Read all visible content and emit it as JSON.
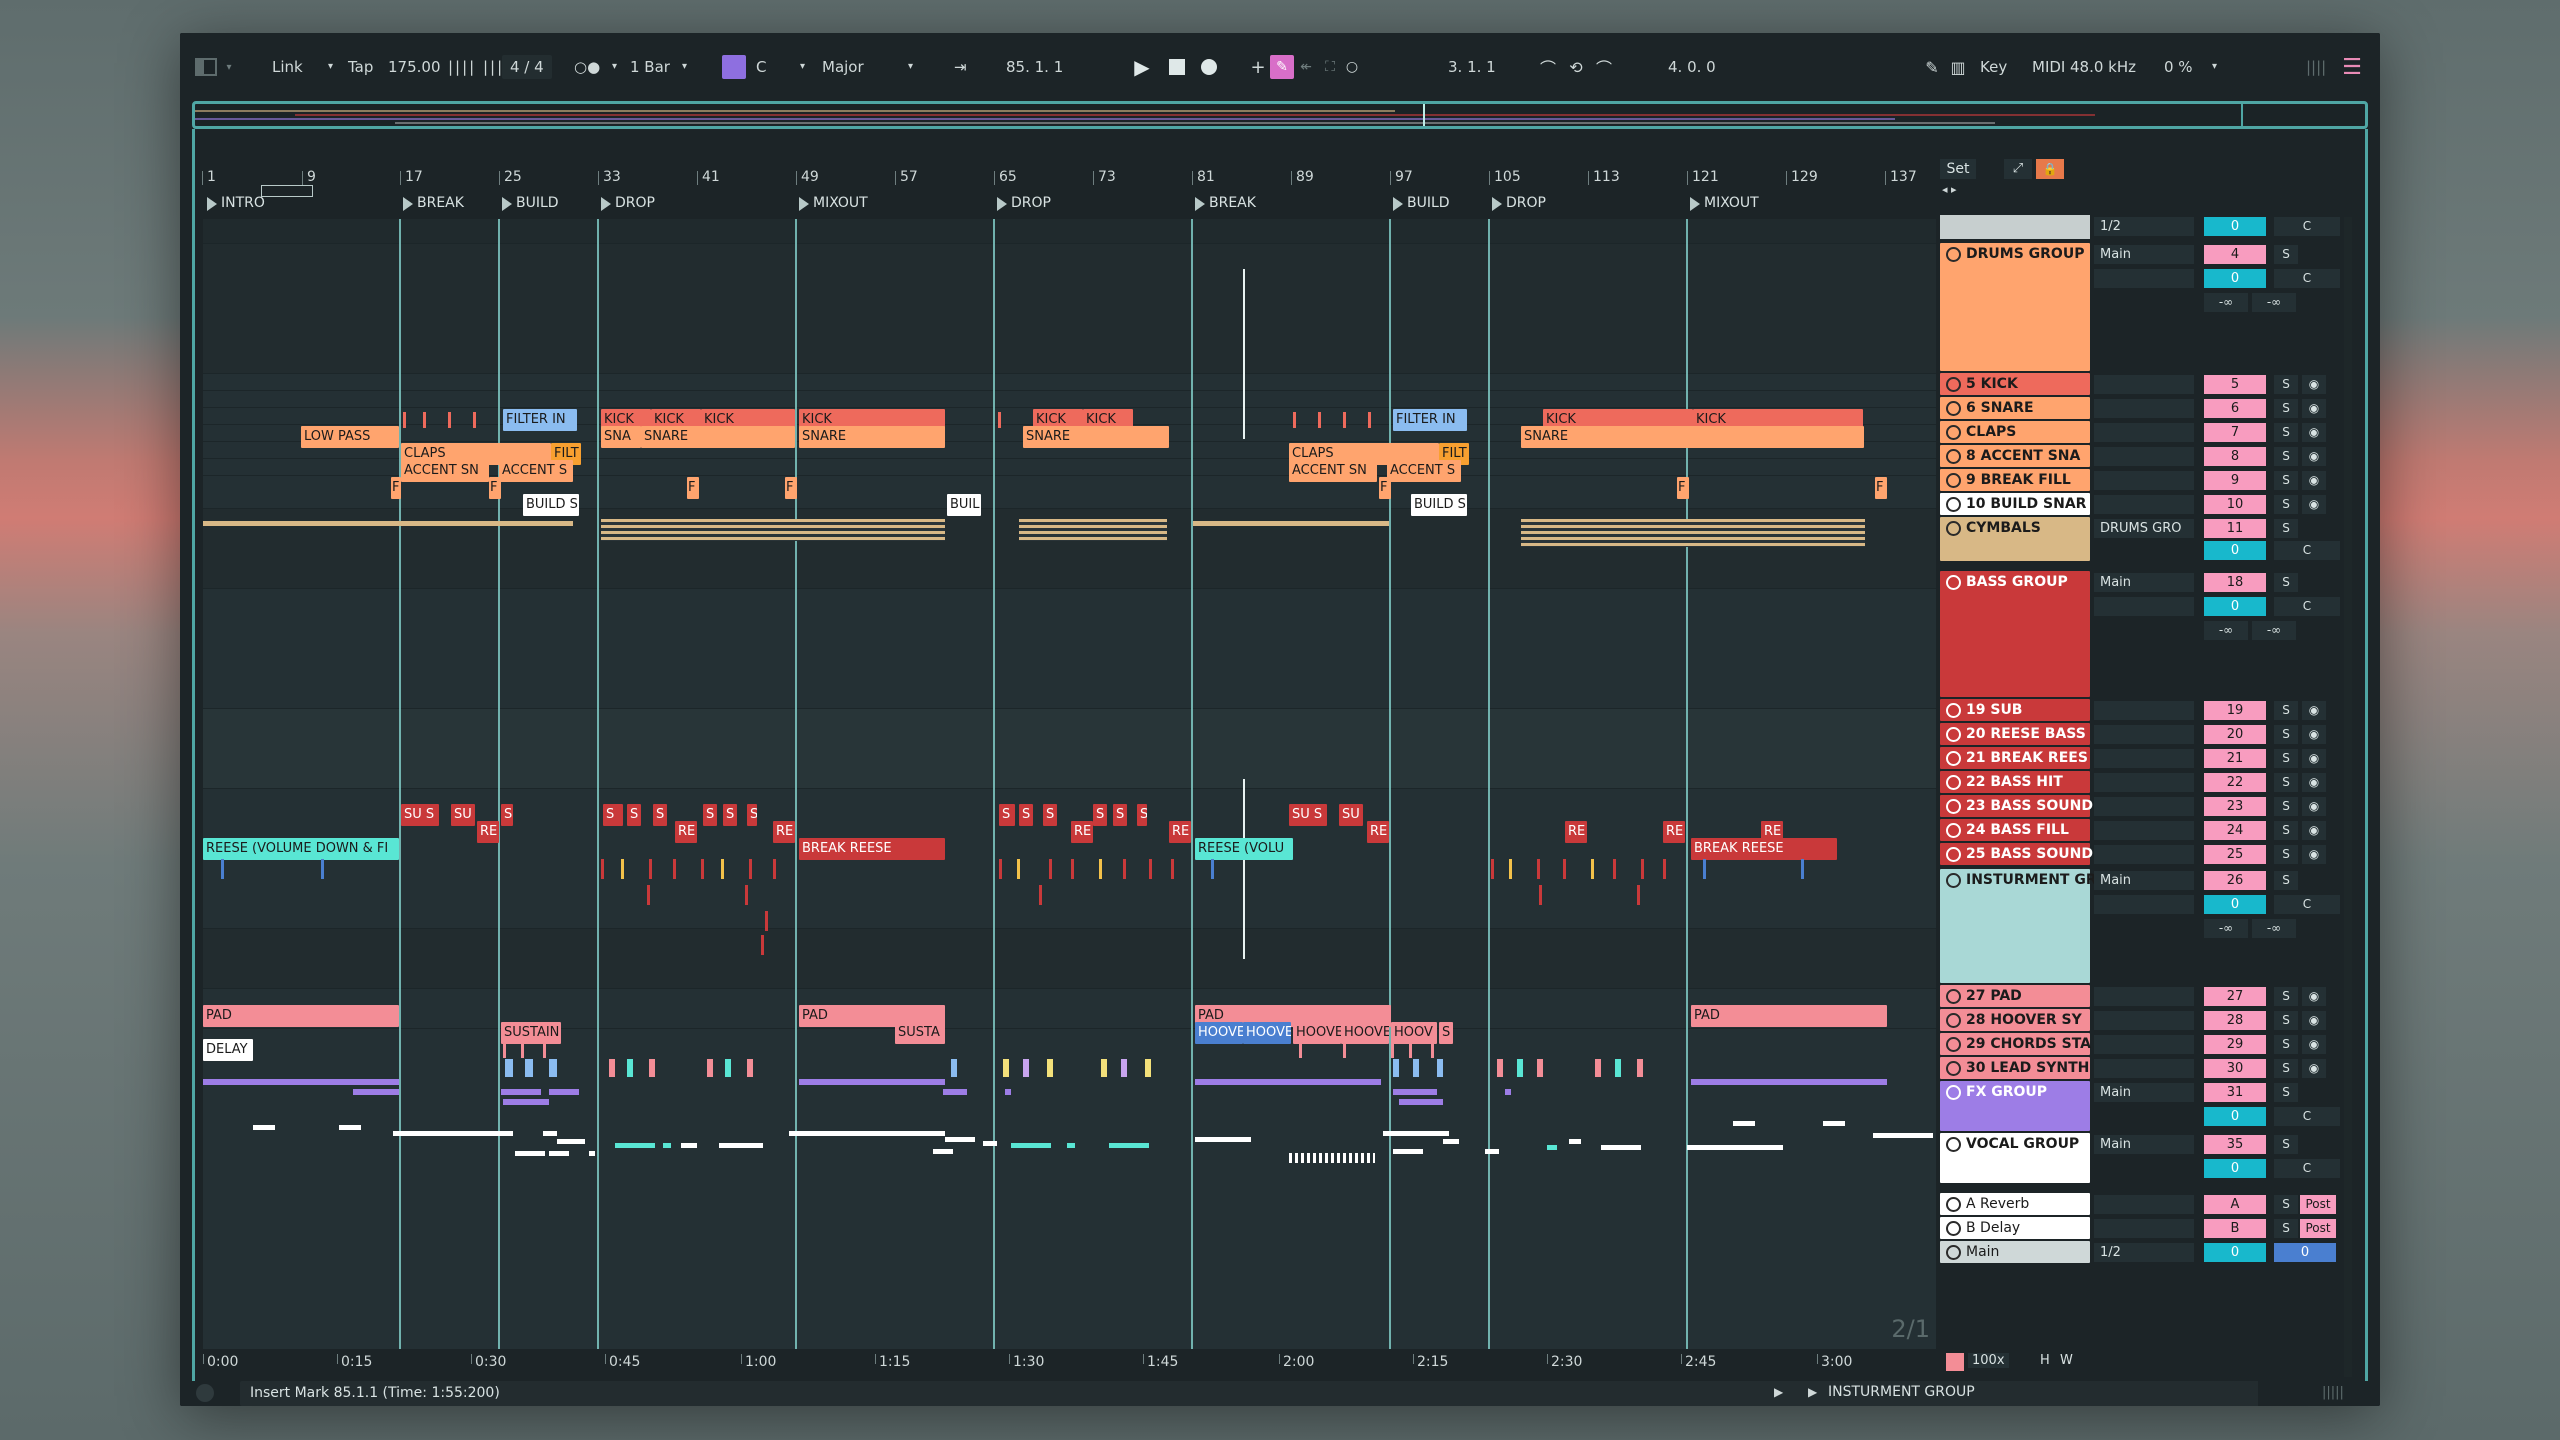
{
  "toolbar": {
    "link": "Link",
    "tap": "Tap",
    "tempo": "175.00",
    "time_sig": "4 / 4",
    "quantize": "1 Bar",
    "key_root": "C",
    "key_scale": "Major",
    "position": "85.  1.  1",
    "loop_start": "3.  1.  1",
    "loop_length": "4.  0.  0",
    "key_label": "Key",
    "midi_label": "MIDI",
    "sample_rate": "48.0 kHz",
    "cpu": "0 %"
  },
  "ruler": {
    "bars": [
      "1",
      "9",
      "17",
      "25",
      "33",
      "41",
      "49",
      "57",
      "65",
      "73",
      "81",
      "89",
      "97",
      "105",
      "113",
      "121",
      "129",
      "137"
    ]
  },
  "locators": [
    "INTRO",
    "BREAK",
    "BUILD",
    "DROP",
    "MIXOUT",
    "DROP",
    "BREAK",
    "BUILD",
    "DROP",
    "MIXOUT"
  ],
  "timeline": {
    "times": [
      "0:00",
      "0:15",
      "0:30",
      "0:45",
      "1:00",
      "1:15",
      "1:30",
      "1:45",
      "2:00",
      "2:15",
      "2:30",
      "2:45",
      "3:00"
    ]
  },
  "clips": {
    "filter_in": "FILTER IN",
    "kick": "KICK",
    "low_pass": "LOW PASS",
    "snare": "SNARE",
    "snare_short": "SNA",
    "claps": "CLAPS",
    "filt": "FILT",
    "accent_sn": "ACCENT SN",
    "accent_s": "ACCENT S",
    "f": "F",
    "build_sn": "BUILD SN",
    "build_short": "BUIL",
    "su": "SU",
    "su_s": "SU S",
    "s": "S",
    "re": "RE",
    "reese_volume": "REESE (VOLUME DOWN & FI",
    "reese_volu": "REESE (VOLU",
    "break_reese": "BREAK REESE",
    "pad": "PAD",
    "sustain": "SUSTAIN",
    "susta": "SUSTA",
    "delay": "DELAY",
    "hoove": "HOOVE",
    "hoov": "HOOV"
  },
  "mixer": {
    "set_label": "Set",
    "tracks": [
      {
        "name": "DRUMS GROUP",
        "output": "Main",
        "number": "4",
        "send": "0",
        "pan": "C"
      },
      {
        "name": "5 KICK",
        "number": "5"
      },
      {
        "name": "6 SNARE",
        "number": "6"
      },
      {
        "name": "CLAPS",
        "number": "7"
      },
      {
        "name": "8 ACCENT SNA",
        "number": "8"
      },
      {
        "name": "9 BREAK FILL",
        "number": "9"
      },
      {
        "name": "10 BUILD SNAR",
        "number": "10"
      },
      {
        "name": "CYMBALS",
        "output": "DRUMS GRO",
        "number": "11",
        "send": "0",
        "pan": "C"
      },
      {
        "name": "BASS GROUP",
        "output": "Main",
        "number": "18",
        "send": "0",
        "pan": "C"
      },
      {
        "name": "19 SUB",
        "number": "19"
      },
      {
        "name": "20 REESE BASS",
        "number": "20"
      },
      {
        "name": "21 BREAK REES",
        "number": "21"
      },
      {
        "name": "22 BASS HIT",
        "number": "22"
      },
      {
        "name": "23 BASS SOUND",
        "number": "23"
      },
      {
        "name": "24 BASS FILL",
        "number": "24"
      },
      {
        "name": "25 BASS SOUND",
        "number": "25"
      },
      {
        "name": "INSTURMENT GR",
        "output": "Main",
        "number": "26",
        "send": "0",
        "pan": "C"
      },
      {
        "name": "27 PAD",
        "number": "27"
      },
      {
        "name": "28 HOOVER SY",
        "number": "28"
      },
      {
        "name": "29 CHORDS STA",
        "number": "29"
      },
      {
        "name": "30 LEAD SYNTH",
        "number": "30"
      },
      {
        "name": "FX GROUP",
        "output": "Main",
        "number": "31",
        "send": "0",
        "pan": "C"
      },
      {
        "name": "VOCAL GROUP",
        "output": "Main",
        "number": "35",
        "send": "0",
        "pan": "C"
      },
      {
        "name": "A Reverb",
        "number": "A",
        "post": "Post"
      },
      {
        "name": "B Delay",
        "number": "B",
        "post": "Post"
      },
      {
        "name": "Main",
        "output": "1/2",
        "number": "0",
        "send": "0"
      }
    ],
    "top_output": "1/2",
    "top_send": "0",
    "top_pan": "C",
    "neg_inf": "-∞",
    "solo": "S",
    "zoom": "100x",
    "h": "H",
    "w": "W"
  },
  "page_indicator": "2/1",
  "status": {
    "message": "Insert Mark 85.1.1 (Time: 1:55:200)",
    "selected_track": "INSTURMENT GROUP"
  },
  "colors": {
    "drums_group": "#ffa46e",
    "drums": "#ee6a5c",
    "snare": "#ffa46e",
    "claps": "#f8a030",
    "cymbals": "#d8b886",
    "bass": "#c9393a",
    "instrument_group": "#a9d8d6",
    "pad": "#f38d96",
    "hoover": "#4a7fd0",
    "fx": "#9d7de6",
    "vocal": "#ffffff",
    "accent_teal": "#18b8cc",
    "num_pink": "#f89cbf"
  }
}
